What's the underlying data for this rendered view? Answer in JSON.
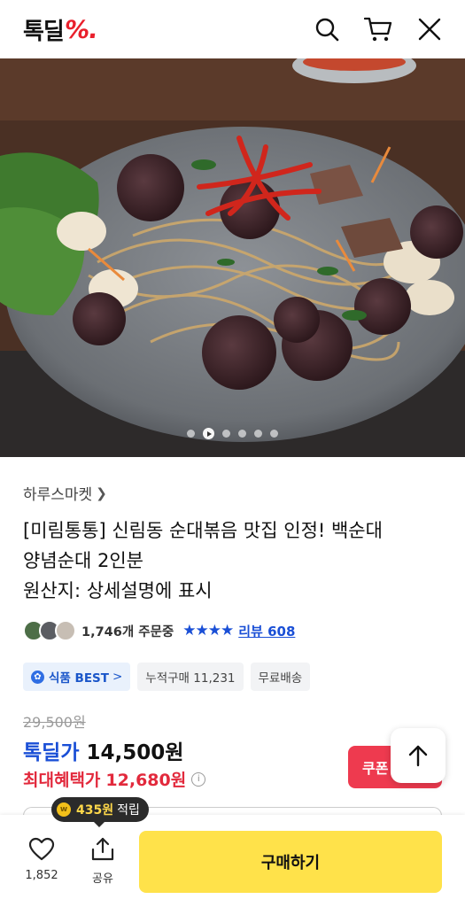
{
  "header": {
    "logo_text": "톡딜",
    "logo_mark": "%.",
    "icons": [
      "search-icon",
      "cart-icon",
      "close-icon"
    ]
  },
  "hero": {
    "slide_count": 6,
    "active_slide": 2
  },
  "product": {
    "store": "하루스마켓",
    "title_line1": "[미림통통] 신림동 순대볶음 맛집 인정! 백순대",
    "title_line2": "양념순대 2인분",
    "title_line3": "원산지: 상세설명에 표시",
    "orders": "1,746개 주문중",
    "rating_stars": 4,
    "review_link": "리뷰 608"
  },
  "tags": {
    "best": "식품 BEST",
    "best_chevron": ">",
    "cumulative": "누적구매 11,231",
    "shipping": "무료배송"
  },
  "price": {
    "original": "29,500원",
    "deal_label": "톡딜가",
    "deal_price": "14,500원",
    "max_label": "최대혜택가",
    "max_price": "12,680원"
  },
  "coupon": {
    "label": "쿠폰"
  },
  "bottom": {
    "points_amount": "435원",
    "points_label": "적립",
    "likes": "1,852",
    "share": "공유",
    "buy": "구매하기"
  },
  "colors": {
    "brand_red": "#e9202c",
    "deal_blue": "#1a4fd6",
    "max_red": "#e2293c",
    "buy_yellow": "#ffe24a"
  }
}
